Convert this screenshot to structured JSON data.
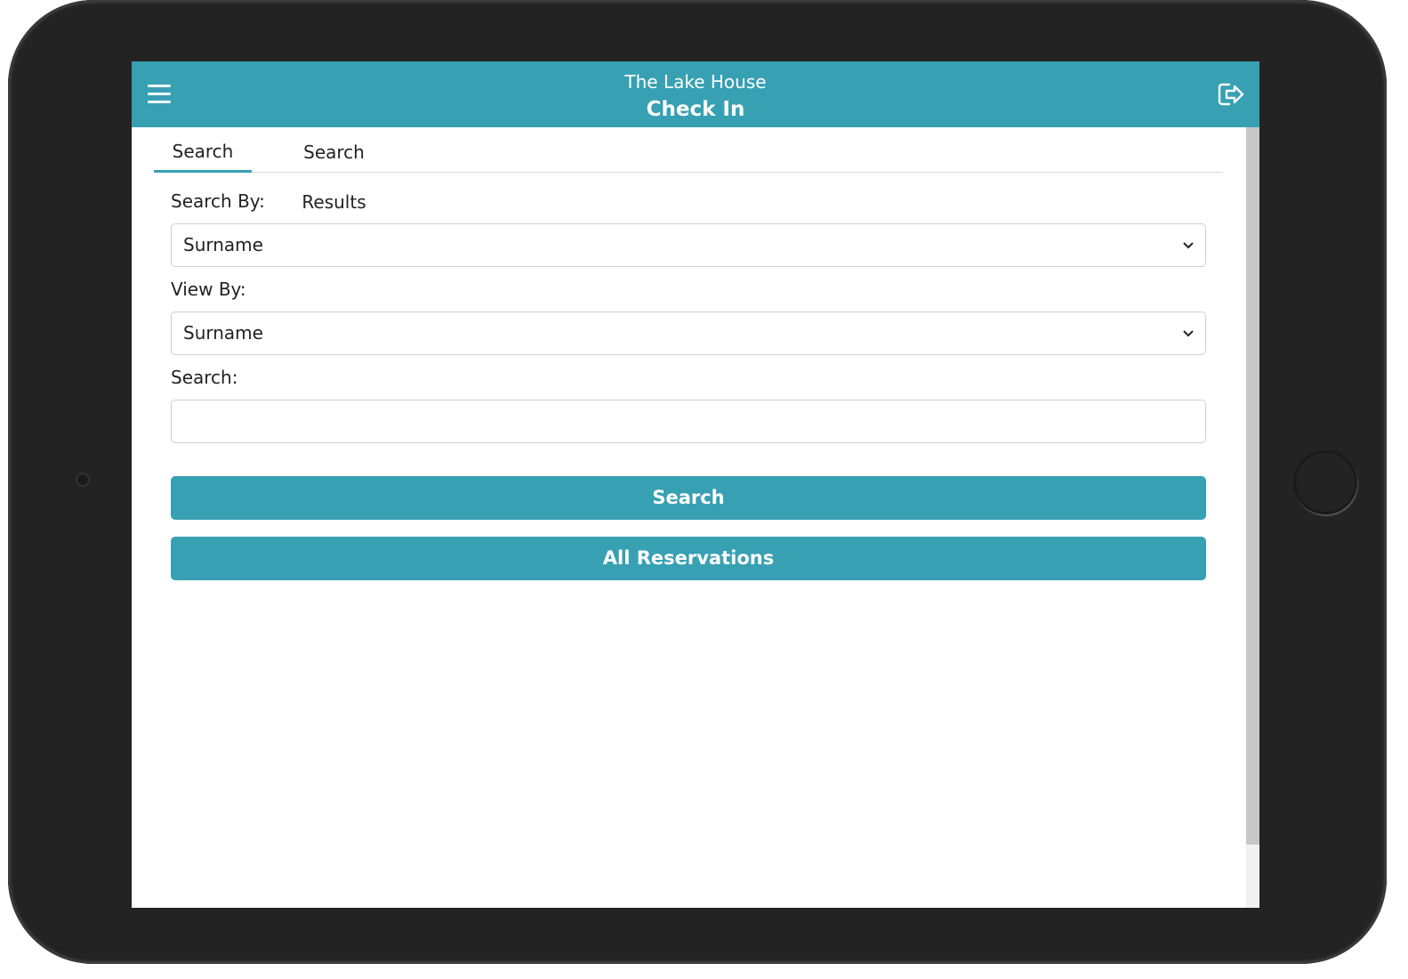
{
  "header": {
    "app_title": "The Lake House",
    "page_title": "Check In"
  },
  "tabs": [
    {
      "label": "Search",
      "active": true
    },
    {
      "label": "Search Results",
      "active": false
    }
  ],
  "form": {
    "search_by": {
      "label": "Search By:",
      "value": "Surname"
    },
    "view_by": {
      "label": "View By:",
      "value": "Surname"
    },
    "search": {
      "label": "Search:",
      "value": "",
      "placeholder": ""
    }
  },
  "buttons": {
    "search_label": "Search",
    "all_reservations_label": "All Reservations"
  },
  "colors": {
    "accent": "#37a0b3",
    "device_frame": "#232323"
  }
}
